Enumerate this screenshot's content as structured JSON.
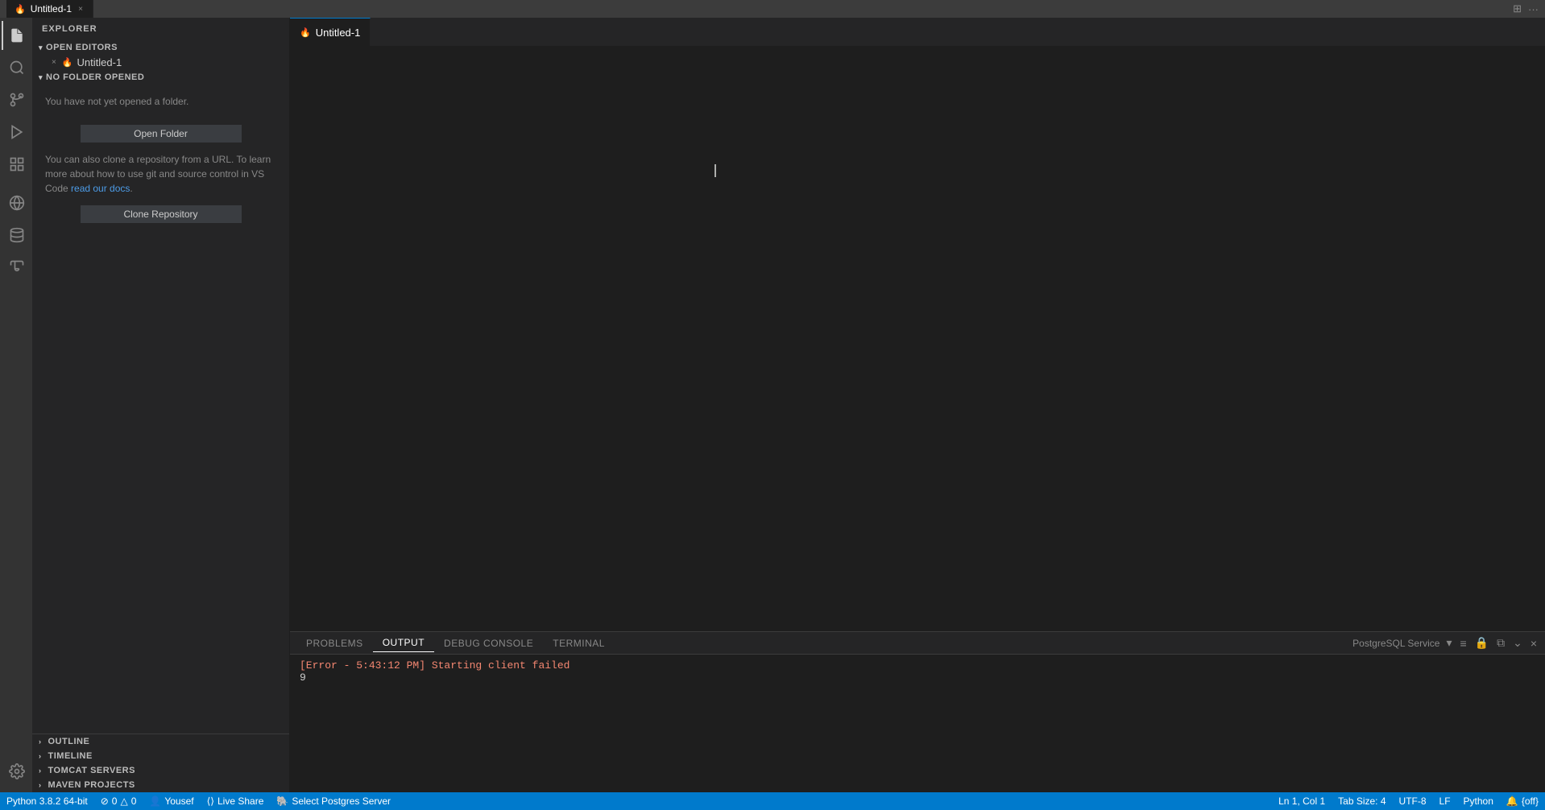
{
  "titlebar": {
    "tab_label": "Untitled-1",
    "tab_icon": "🔥",
    "close_icon": "×",
    "layout_icon": "⊞",
    "more_icon": "..."
  },
  "activity_bar": {
    "items": [
      {
        "id": "explorer",
        "icon": "📄",
        "label": "Explorer",
        "active": true
      },
      {
        "id": "search",
        "icon": "🔍",
        "label": "Search",
        "active": false
      },
      {
        "id": "source-control",
        "icon": "⑂",
        "label": "Source Control",
        "active": false
      },
      {
        "id": "run",
        "icon": "▷",
        "label": "Run",
        "active": false
      },
      {
        "id": "extensions",
        "icon": "⊞",
        "label": "Extensions",
        "active": false
      },
      {
        "id": "remote",
        "icon": "⊙",
        "label": "Remote",
        "active": false
      },
      {
        "id": "database",
        "icon": "🗄",
        "label": "Database",
        "active": false
      },
      {
        "id": "test",
        "icon": "⚗",
        "label": "Test",
        "active": false
      }
    ],
    "bottom_items": [
      {
        "id": "settings",
        "icon": "⚙",
        "label": "Settings"
      }
    ]
  },
  "sidebar": {
    "title": "EXPLORER",
    "sections": {
      "open_editors": {
        "label": "OPEN EDITORS",
        "expanded": true,
        "items": [
          {
            "close_icon": "×",
            "file_icon": "🔥",
            "name": "Untitled-1"
          }
        ]
      },
      "no_folder": {
        "label": "NO FOLDER OPENED",
        "expanded": true,
        "message": "You have not yet opened a folder.",
        "open_button": "Open Folder",
        "clone_text_before": "You can also clone a repository from a URL. To learn more about how to use git and source control in VS Code ",
        "clone_link_text": "read our docs",
        "clone_text_after": ".",
        "clone_button": "Clone Repository"
      }
    },
    "bottom_sections": [
      {
        "id": "outline",
        "label": "OUTLINE",
        "expanded": false
      },
      {
        "id": "timeline",
        "label": "TIMELINE",
        "expanded": false
      },
      {
        "id": "tomcat-servers",
        "label": "TOMCAT SERVERS",
        "expanded": false
      },
      {
        "id": "maven-projects",
        "label": "MAVEN PROJECTS",
        "expanded": false
      }
    ]
  },
  "editor": {
    "tab_label": "Untitled-1",
    "tab_icon": "🔥"
  },
  "panel": {
    "tabs": [
      {
        "id": "problems",
        "label": "PROBLEMS",
        "active": false
      },
      {
        "id": "output",
        "label": "OUTPUT",
        "active": true
      },
      {
        "id": "debug-console",
        "label": "DEBUG CONSOLE",
        "active": false
      },
      {
        "id": "terminal",
        "label": "TERMINAL",
        "active": false
      }
    ],
    "output_source": "PostgreSQL Service",
    "content_lines": [
      {
        "text": "[Error - 5:43:12 PM] Starting client failed",
        "type": "error"
      },
      {
        "text": "9",
        "type": "normal"
      }
    ],
    "actions": {
      "dropdown_icon": "▾",
      "list_icon": "≡",
      "lock_icon": "🔒",
      "copy_icon": "⧉",
      "collapse_icon": "⌄",
      "close_icon": "×"
    }
  },
  "status_bar": {
    "left_items": [
      {
        "id": "git-branch",
        "icon": "⎇",
        "text": "Python 3.8.2 64-bit"
      },
      {
        "id": "errors",
        "icon": "⊘",
        "text": "0"
      },
      {
        "id": "warnings",
        "icon": "△",
        "text": "0"
      },
      {
        "id": "live-share-icon",
        "icon": "🔗",
        "text": ""
      },
      {
        "id": "yousef",
        "icon": "",
        "text": "Yousef"
      },
      {
        "id": "live-share",
        "icon": "⟨⟩",
        "text": "Live Share"
      },
      {
        "id": "postgres",
        "icon": "🐘",
        "text": "Select Postgres Server"
      }
    ],
    "right_items": [
      {
        "id": "ln-col",
        "text": "Ln 1, Col 1"
      },
      {
        "id": "tab-size",
        "text": "Tab Size: 4"
      },
      {
        "id": "encoding",
        "text": "UTF-8"
      },
      {
        "id": "line-ending",
        "text": "LF"
      },
      {
        "id": "language",
        "text": "Python"
      },
      {
        "id": "notifications",
        "icon": "🔔",
        "text": "{off}"
      }
    ]
  }
}
